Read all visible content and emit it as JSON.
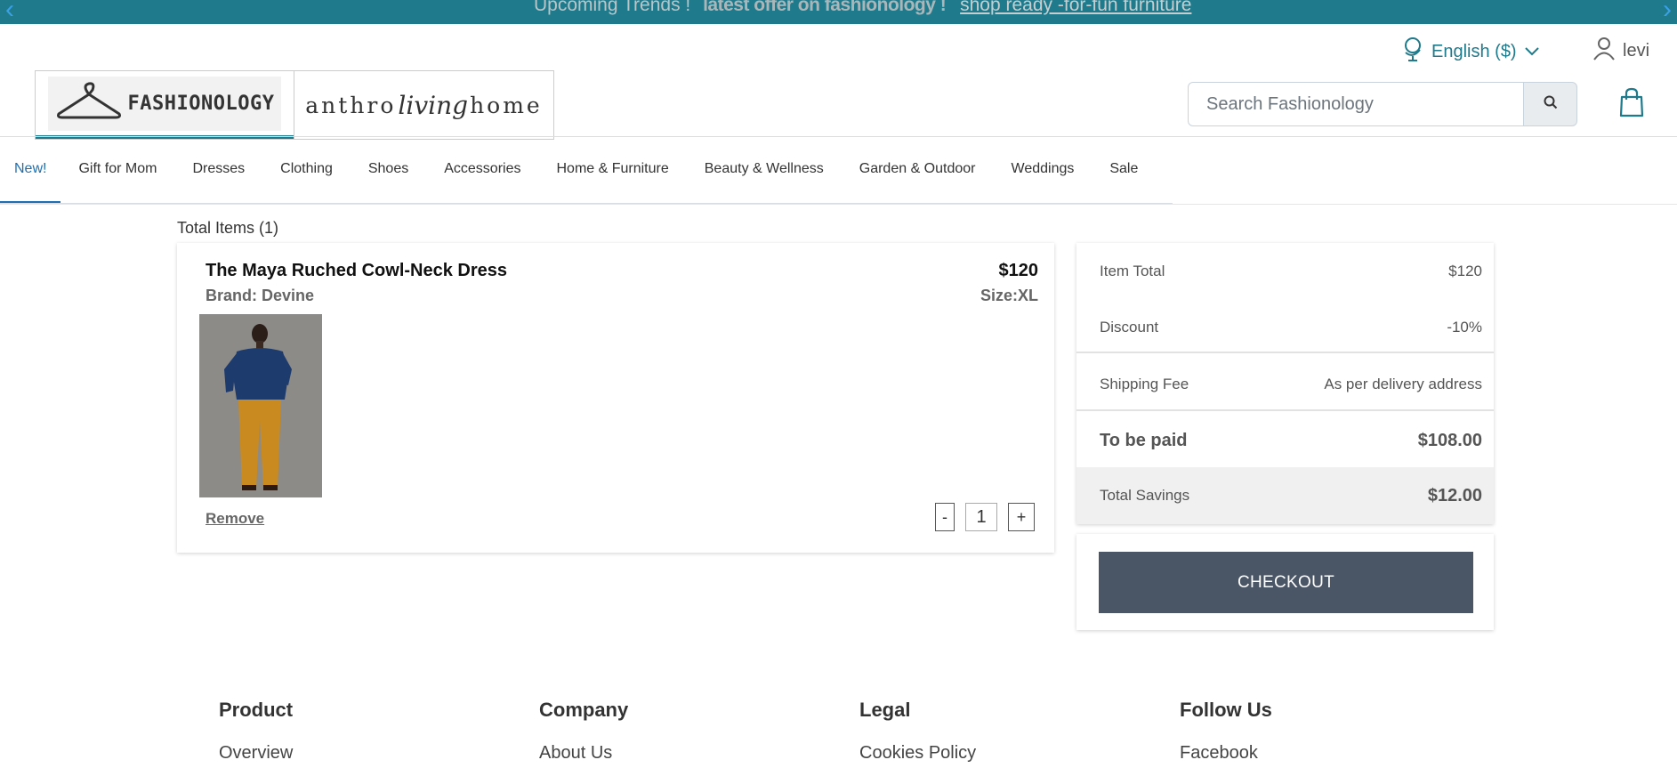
{
  "banner": {
    "text_upcoming": "Upcoming Trends !",
    "text_offer": "latest offer on fashionology !",
    "link": "shop ready -for-fun furniture"
  },
  "utility": {
    "language": "English ($)",
    "user": "levi"
  },
  "logos": {
    "fashionology": "FASHIONOLOGY",
    "anthro_left": "anthro",
    "anthro_script": "living",
    "anthro_right": "home"
  },
  "search": {
    "placeholder": "Search Fashionology"
  },
  "nav": {
    "items": [
      "New!",
      "Gift for Mom",
      "Dresses",
      "Clothing",
      "Shoes",
      "Accessories",
      "Home & Furniture",
      "Beauty & Wellness",
      "Garden & Outdoor",
      "Weddings",
      "Sale"
    ]
  },
  "cart": {
    "total_items": "Total Items (1)",
    "item": {
      "name": "The Maya Ruched Cowl-Neck Dress",
      "brand": "Brand: Devine",
      "price": "$120",
      "size": "Size:XL",
      "remove": "Remove",
      "qty_minus": "-",
      "qty": "1",
      "qty_plus": "+"
    }
  },
  "summary": {
    "item_total_label": "Item Total",
    "item_total": "$120",
    "discount_label": "Discount",
    "discount": "-10%",
    "shipping_label": "Shipping Fee",
    "shipping": "As per delivery address",
    "to_pay_label": "To be paid",
    "to_pay": "$108.00",
    "savings_label": "Total Savings",
    "savings": "$12.00",
    "checkout": "CHECKOUT"
  },
  "footer": {
    "columns": [
      {
        "heading": "Product",
        "link": "Overview"
      },
      {
        "heading": "Company",
        "link": "About Us"
      },
      {
        "heading": "Legal",
        "link": "Cookies Policy"
      },
      {
        "heading": "Follow Us",
        "link": "Facebook"
      }
    ]
  },
  "colors": {
    "banner_bg": "#1f7a8c",
    "accent": "#1f7a8c",
    "nav_active": "#1f6fb0",
    "checkout_bg": "#4a5566"
  }
}
